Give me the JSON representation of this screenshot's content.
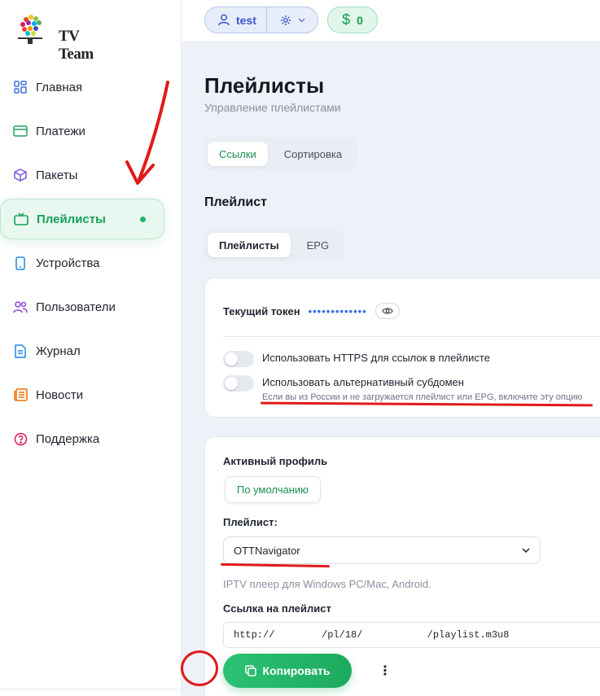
{
  "brand": {
    "logo_text": "TV Team"
  },
  "sidebar": {
    "items": [
      {
        "label": "Главная",
        "icon": "dashboard-icon"
      },
      {
        "label": "Платежи",
        "icon": "card-icon"
      },
      {
        "label": "Пакеты",
        "icon": "box-icon"
      },
      {
        "label": "Плейлисты",
        "icon": "tv-icon",
        "active": true
      },
      {
        "label": "Устройства",
        "icon": "phone-icon"
      },
      {
        "label": "Пользователи",
        "icon": "users-icon"
      },
      {
        "label": "Журнал",
        "icon": "document-icon"
      },
      {
        "label": "Новости",
        "icon": "news-icon"
      },
      {
        "label": "Поддержка",
        "icon": "help-icon"
      }
    ]
  },
  "topbar": {
    "username": "test",
    "balance": "0"
  },
  "page": {
    "title": "Плейлисты",
    "subtitle": "Управление плейлистами",
    "tabs": [
      {
        "label": "Ссылки",
        "active": true
      },
      {
        "label": "Сортировка"
      }
    ],
    "section_title": "Плейлист",
    "subtabs": [
      {
        "label": "Плейлисты",
        "active": true
      },
      {
        "label": "EPG"
      }
    ]
  },
  "token_card": {
    "token_label": "Текущий токен",
    "token_masked": "•••••••••••••",
    "https_label": "Использовать HTTPS для ссылок в плейлисте",
    "https_enabled": false,
    "alt_label": "Использовать альтернативный субдомен",
    "alt_enabled": false,
    "alt_hint": "Если вы из России и не загружается плейлист или EPG, включите эту опцию"
  },
  "playlist_card": {
    "profile_label": "Активный профиль",
    "profile_value": "По умолчанию",
    "playlist_label": "Плейлист:",
    "playlist_selected": "OTTNavigator",
    "playlist_desc": "IPTV плеер для Windows PC/Mac, Android.",
    "link_label": "Ссылка на плейлист",
    "link_value": "http://        /pl/18/           /playlist.m3u8",
    "copy_label": "Копировать",
    "more_label": "⋮"
  },
  "colors": {
    "accent": "#1daa5e",
    "annotation": "#e01a1a",
    "user_pill": "#3856c9"
  }
}
